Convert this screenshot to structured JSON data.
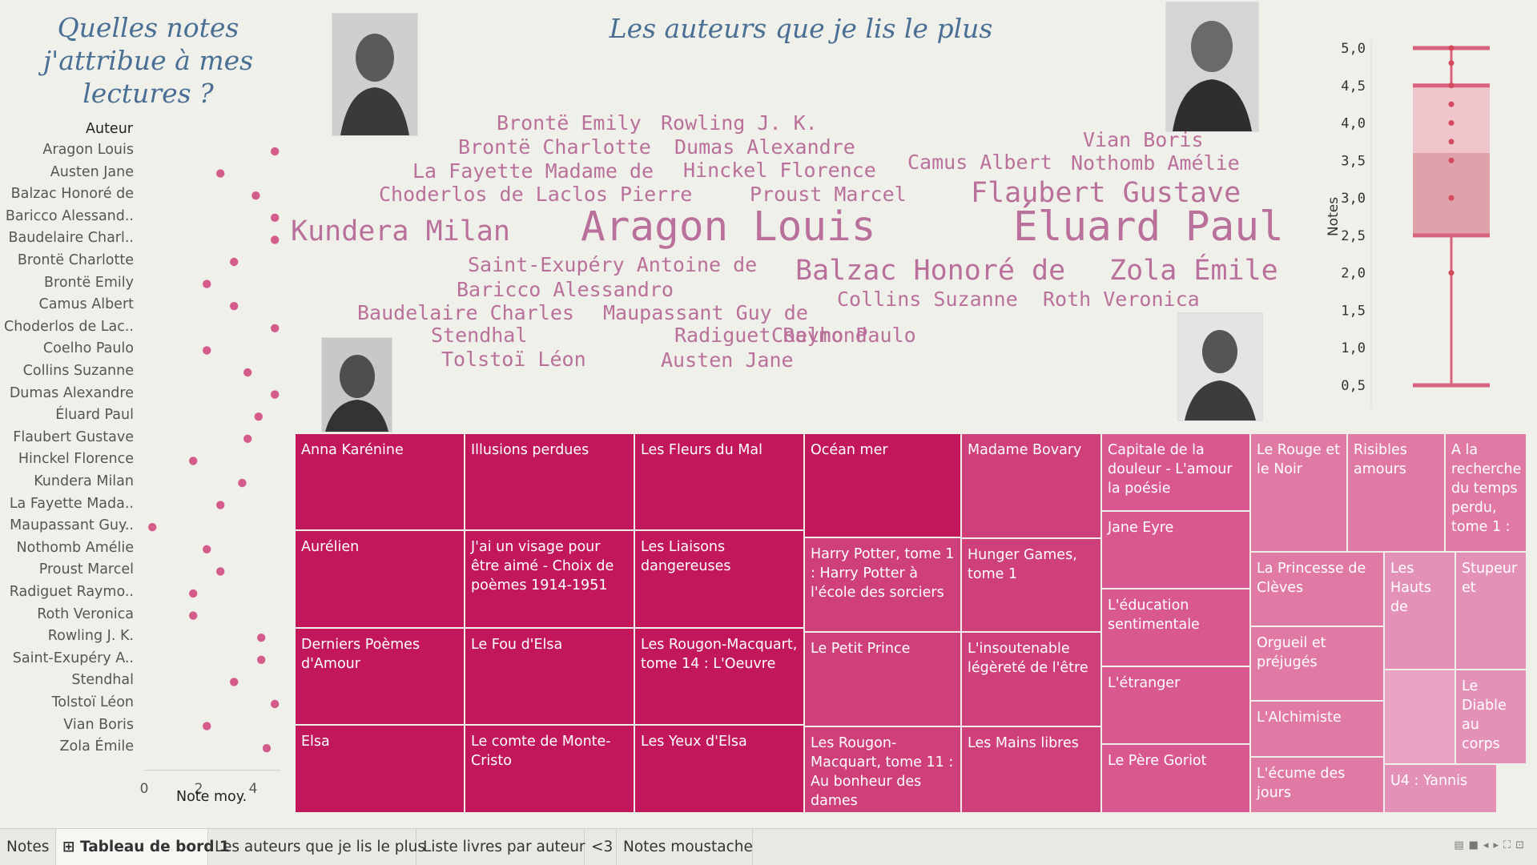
{
  "left_title": "Quelles notes j'attribue à mes lectures ?",
  "cloud_title": "Les auteurs que je lis le plus",
  "dot_header": "Auteur",
  "dot_xlabel": "Note moy.",
  "box_ylabel": "Notes",
  "colors": {
    "dot": "#d45c8a",
    "cloud": "#b9709a",
    "title": "#4a6f94",
    "tm_dark": "#c2185b",
    "tm_light": "#e391b6",
    "box": "#d9627f"
  },
  "chart_data": [
    {
      "type": "scatter",
      "xlabel": "Note moy.",
      "ylabel": "Auteur",
      "xlim": [
        0,
        5
      ],
      "xticks": [
        "0",
        "2",
        "4"
      ],
      "categories": [
        "Aragon Louis",
        "Austen Jane",
        "Balzac Honoré de",
        "Baricco Alessand..",
        "Baudelaire Charl..",
        "Brontë Charlotte",
        "Brontë Emily",
        "Camus Albert",
        "Choderlos de Lac..",
        "Coelho Paulo",
        "Collins Suzanne",
        "Dumas Alexandre",
        "Éluard Paul",
        "Flaubert Gustave",
        "Hinckel Florence",
        "Kundera Milan",
        "La Fayette Mada..",
        "Maupassant Guy..",
        "Nothomb Amélie",
        "Proust Marcel",
        "Radiguet Raymo..",
        "Roth Veronica",
        "Rowling J. K.",
        "Saint-Exupéry A..",
        "Stendhal",
        "Tolstoï Léon",
        "Vian Boris",
        "Zola Émile"
      ],
      "values": [
        4.8,
        2.8,
        4.1,
        4.8,
        4.8,
        3.3,
        2.3,
        3.3,
        4.8,
        2.3,
        3.8,
        4.8,
        4.2,
        3.8,
        1.8,
        3.6,
        2.8,
        0.3,
        2.3,
        2.8,
        1.8,
        1.8,
        4.3,
        4.3,
        3.3,
        4.8,
        2.3,
        4.5
      ]
    },
    {
      "type": "wordcloud",
      "words": [
        {
          "text": "Brontë Emily",
          "size": 25
        },
        {
          "text": "Rowling J. K.",
          "size": 25
        },
        {
          "text": "Brontë Charlotte",
          "size": 25
        },
        {
          "text": "Dumas Alexandre",
          "size": 25
        },
        {
          "text": "Vian Boris",
          "size": 25
        },
        {
          "text": "La Fayette Madame de",
          "size": 25
        },
        {
          "text": "Hinckel Florence",
          "size": 25
        },
        {
          "text": "Camus Albert",
          "size": 25
        },
        {
          "text": "Nothomb Amélie",
          "size": 25
        },
        {
          "text": "Choderlos de Laclos Pierre",
          "size": 25
        },
        {
          "text": "Proust Marcel",
          "size": 25
        },
        {
          "text": "Flaubert Gustave",
          "size": 35
        },
        {
          "text": "Kundera Milan",
          "size": 35
        },
        {
          "text": "Aragon Louis",
          "size": 51
        },
        {
          "text": "Éluard Paul",
          "size": 51
        },
        {
          "text": "Saint-Exupéry Antoine de",
          "size": 25
        },
        {
          "text": "Balzac Honoré de",
          "size": 35
        },
        {
          "text": "Zola Émile",
          "size": 35
        },
        {
          "text": "Baricco Alessandro",
          "size": 25
        },
        {
          "text": "Collins Suzanne",
          "size": 25
        },
        {
          "text": "Roth Veronica",
          "size": 25
        },
        {
          "text": "Baudelaire Charles",
          "size": 25
        },
        {
          "text": "Maupassant Guy de",
          "size": 25
        },
        {
          "text": "Stendhal",
          "size": 25
        },
        {
          "text": "Radiguet Raymond",
          "size": 25
        },
        {
          "text": "Coelho Paulo",
          "size": 25
        },
        {
          "text": "Tolstoï Léon",
          "size": 25
        },
        {
          "text": "Austen Jane",
          "size": 25
        }
      ]
    },
    {
      "type": "box",
      "ylabel": "Notes",
      "ylim": [
        0,
        5
      ],
      "yticks": [
        "0,5",
        "1,0",
        "1,5",
        "2,0",
        "2,5",
        "3,0",
        "3,5",
        "4,0",
        "4,5",
        "5,0"
      ],
      "whisker_low": 0.5,
      "q1": 2.5,
      "median": 3.6,
      "q3": 4.5,
      "whisker_high": 5.0,
      "points": [
        5.0,
        4.8,
        4.5,
        4.25,
        4.0,
        3.75,
        3.5,
        3.0,
        2.0
      ]
    },
    {
      "type": "treemap",
      "items": [
        "Anna Karénine",
        "Aurélien",
        "Derniers Poèmes d'Amour",
        "Elsa",
        "Illusions perdues",
        "J'ai un visage pour être aimé - Choix de poèmes 1914-1951",
        "Le Fou d'Elsa",
        "Le comte de Monte-Cristo",
        "Les Fleurs du Mal",
        "Les Liaisons dangereuses",
        "Les Rougon-Macquart, tome 14 : L'Oeuvre",
        "Les Yeux d'Elsa",
        "Océan mer",
        "Harry Potter, tome 1 : Harry Potter à l'école des sorciers",
        "Le Petit Prince",
        "Les Rougon-Macquart, tome 11 : Au bonheur des dames",
        "Madame Bovary",
        "Hunger Games, tome 1",
        "L'insoutenable légèreté de l'être",
        "Les Mains libres",
        "Capitale de la douleur - L'amour la poésie",
        "Jane Eyre",
        "L'éducation sentimentale",
        "L'étranger",
        "Le Père Goriot",
        "Le Rouge et le Noir",
        "Risibles amours",
        "A la recherche du temps perdu, tome 1 :",
        "La Princesse de Clèves",
        "Orgueil et préjugés",
        "L'Alchimiste",
        "L'écume des jours",
        "Les Hauts de",
        "Stupeur et",
        "Le Diable au corps",
        "U4 : Yannis"
      ]
    }
  ],
  "tabs": [
    "Notes",
    "Tableau de bord 1",
    "Les auteurs que je lis le plus",
    "Liste livres par auteur",
    "<3",
    "Notes moustache"
  ],
  "active_tab": "Tableau de bord 1"
}
